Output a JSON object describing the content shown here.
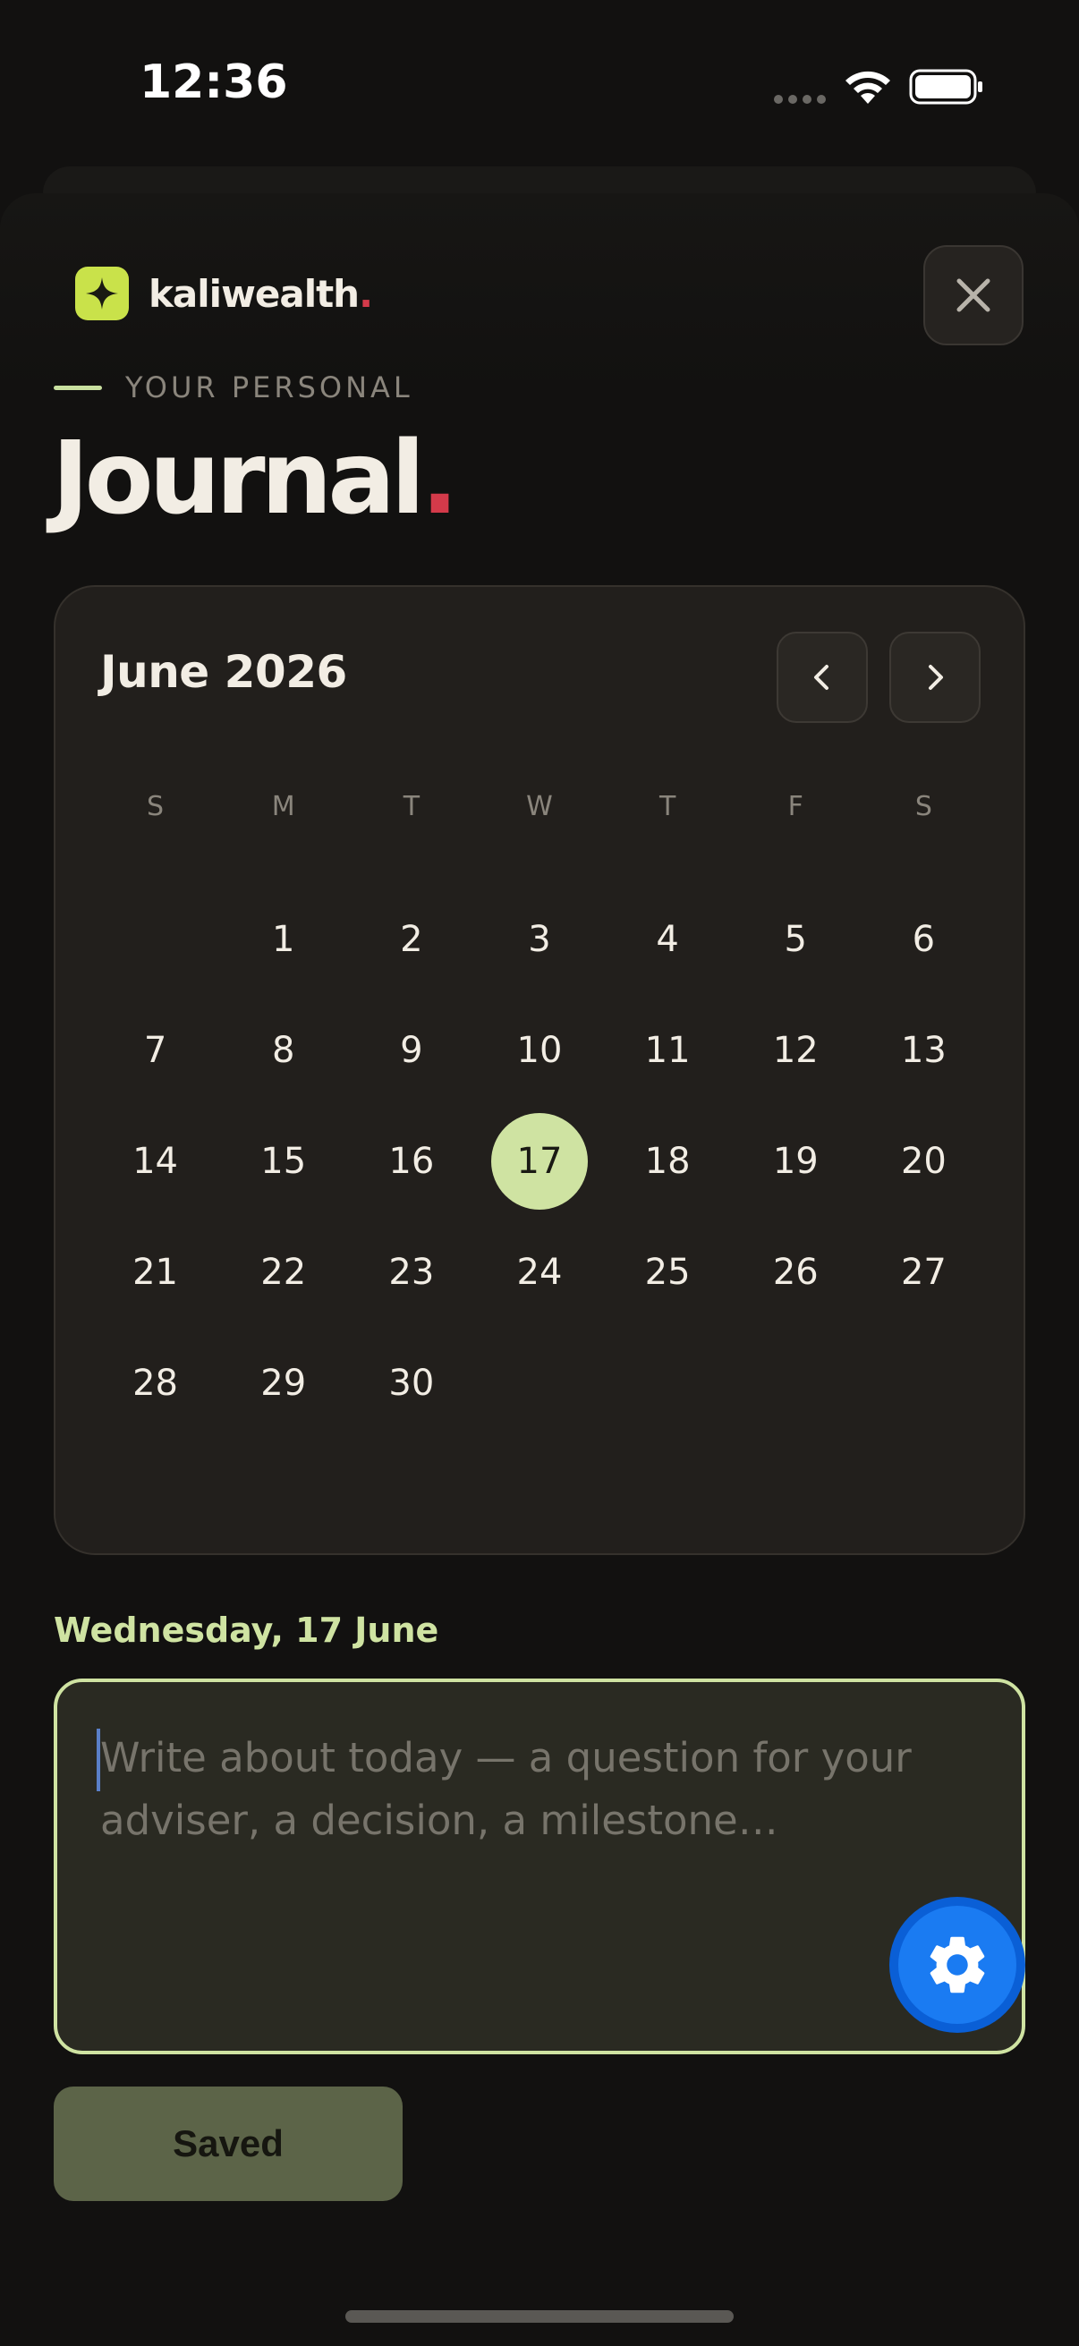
{
  "status_bar": {
    "time": "12:36"
  },
  "brand": {
    "name": "kaliwealth",
    "dot": ".",
    "logo_icon": "sparkle-icon",
    "accent": "#c9e24a"
  },
  "header": {
    "close_icon": "close-icon",
    "eyebrow": "YOUR PERSONAL",
    "title": "Journal",
    "title_dot": "."
  },
  "calendar": {
    "month_label": "June 2026",
    "prev_icon": "chevron-left-icon",
    "next_icon": "chevron-right-icon",
    "weekdays": [
      "S",
      "M",
      "T",
      "W",
      "T",
      "F",
      "S"
    ],
    "first_weekday_index": 1,
    "days_in_month": 30,
    "selected_day": 17,
    "selected_color": "#cfe3a2"
  },
  "entry": {
    "date_heading": "Wednesday, 17 June",
    "placeholder": "Write about today — a question for your adviser, a decision, a milestone…",
    "value": "",
    "fab_icon": "gear-icon"
  },
  "actions": {
    "saved_label": "Saved"
  },
  "colors": {
    "background": "#121110",
    "card": "#221f1c",
    "accent_red": "#d43a4a",
    "accent_green": "#cfe3a2",
    "fab_blue": "#1a7bf2"
  }
}
